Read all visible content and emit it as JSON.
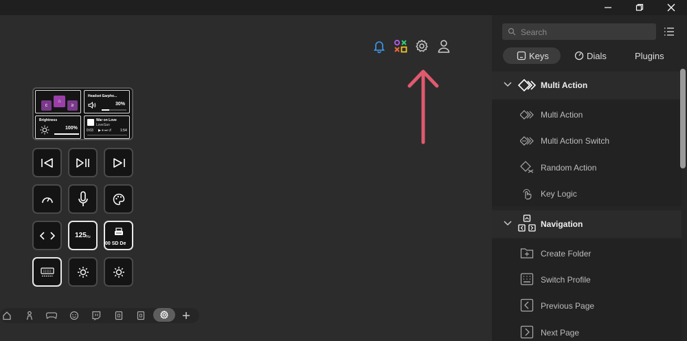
{
  "titlebar": {
    "minimize_icon": "minimize-icon",
    "restore_icon": "restore-icon",
    "close_icon": "close-icon"
  },
  "toolbar": {
    "icons": [
      "bell-icon",
      "marketplace-icon",
      "gear-icon",
      "user-icon"
    ],
    "arrow_color": "#e05a6e"
  },
  "lcd": {
    "keys": [
      "c",
      "⌂",
      "≥"
    ],
    "audio_title": "Headset Earpho...",
    "audio_value": "30%",
    "brightness_label": "Brightness",
    "brightness_value": "100%",
    "brightness_level": 1.0,
    "audio_level": 0.3,
    "media_title": "War on Love",
    "media_artist": "LoveSan",
    "media_time_start": "0:03",
    "media_time_end": "1:54"
  },
  "keys": {
    "rate_label": "125",
    "rate_unit": "Hz",
    "device_label": "00 SD De"
  },
  "bottom_bar": {
    "icons": [
      "home-icon",
      "person-icon",
      "gamepad-icon",
      "emoji-icon",
      "twitch-icon",
      "page-icon",
      "page-icon-2",
      "settings-icon",
      "add-icon"
    ],
    "active": "settings-icon"
  },
  "sidebar": {
    "search_placeholder": "Search",
    "tabs": [
      {
        "label": "Keys",
        "active": true
      },
      {
        "label": "Dials",
        "active": false
      },
      {
        "label": "Plugins",
        "active": false
      }
    ],
    "groups": [
      {
        "title": "Multi Action",
        "items": [
          "Multi Action",
          "Multi Action Switch",
          "Random Action",
          "Key Logic"
        ]
      },
      {
        "title": "Navigation",
        "items": [
          "Create Folder",
          "Switch Profile",
          "Previous Page",
          "Next Page"
        ]
      }
    ]
  }
}
